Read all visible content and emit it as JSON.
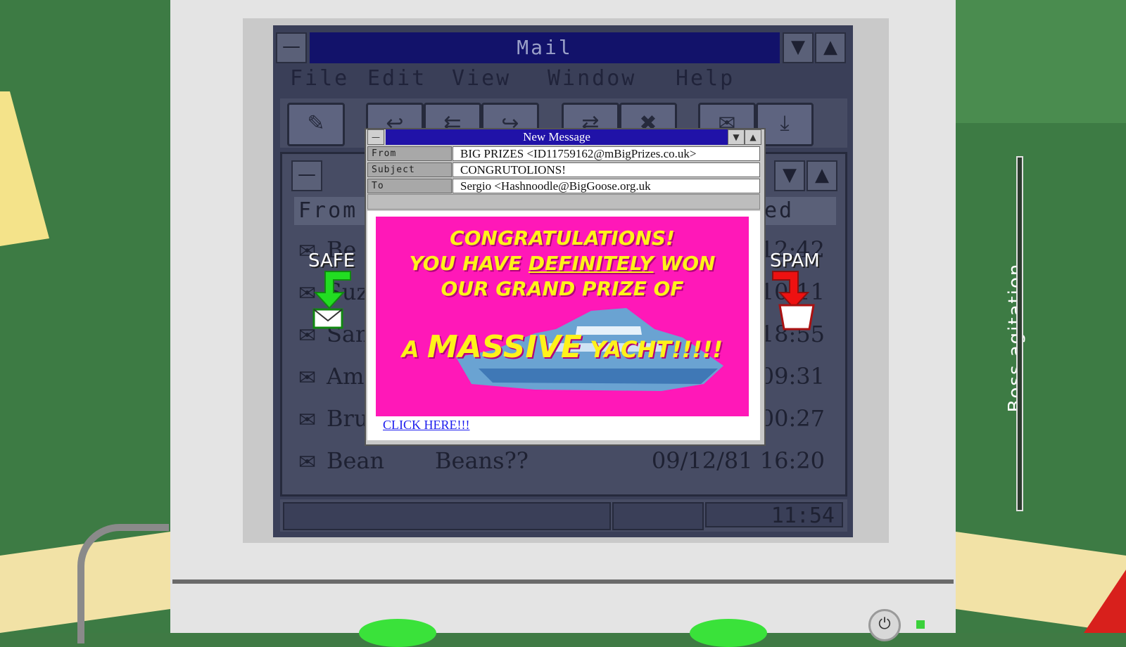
{
  "mail_window": {
    "title": "Mail",
    "menu": [
      "File",
      "Edit",
      "View",
      "Window",
      "Help"
    ]
  },
  "inbox": {
    "columns": {
      "from": "From",
      "received": "ed"
    },
    "rows": [
      {
        "from": "Be",
        "subject": "",
        "received": "12:42"
      },
      {
        "from": "Suz",
        "subject": "",
        "received": "10:11"
      },
      {
        "from": "San",
        "subject": "",
        "received": "18:55"
      },
      {
        "from": "Am",
        "subject": "",
        "received": "09:31"
      },
      {
        "from": "Bru",
        "subject": "",
        "received": "00:27"
      },
      {
        "from": "Bean",
        "subject": "Beans??",
        "received": "09/12/81 16:20"
      }
    ]
  },
  "status_bar": {
    "clock": "11:54"
  },
  "markers": {
    "safe": "SAFE",
    "spam": "SPAM"
  },
  "new_message": {
    "title": "New Message",
    "from_label": "From",
    "from_value": "BIG PRIZES <ID11759162@mBigPrizes.co.uk>",
    "subject_label": "Subject",
    "subject_value": "CONGRUTOLIONS!",
    "to_label": "To",
    "to_value": "Sergio <Hashnoodle@BigGoose.org.uk",
    "ad": {
      "line1": "CONGRATULATIONS!",
      "line2_a": "YOU HAVE ",
      "line2_b": "DEFINITELY",
      "line2_c": " WON",
      "line3": "OUR GRAND PRIZE OF",
      "line4_a": "A ",
      "line4_b": "MASSIVE",
      "line4_c": " YACHT!!!!!"
    },
    "link": "CLICK HERE!!!"
  },
  "boss": {
    "label": "Boss agitation"
  },
  "colors": {
    "titlebar": "#12126a",
    "popup_titlebar": "#2012a8",
    "ad_background": "#ff18b8",
    "ad_text": "#fff21a",
    "safe": "#22dd22",
    "spam": "#ee1111"
  }
}
